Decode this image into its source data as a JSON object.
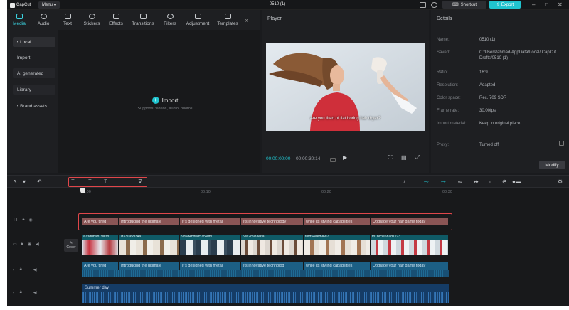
{
  "app": {
    "logo_text": "CapCut",
    "menu_label": "Menu",
    "doc_title": "0510 (1)",
    "shortcut_label": "Shortcut",
    "export_label": "Export"
  },
  "colors": {
    "accent": "#20c4cf",
    "highlight_box": "#e0464a",
    "text_clip": "#8a5555",
    "video_clip": "#0f5a66",
    "audio_clip": "#1c5f85"
  },
  "media_tabs": [
    {
      "label": "Media",
      "icon": "media-icon"
    },
    {
      "label": "Audio",
      "icon": "audio-icon"
    },
    {
      "label": "Text",
      "icon": "text-icon"
    },
    {
      "label": "Stickers",
      "icon": "stickers-icon"
    },
    {
      "label": "Effects",
      "icon": "effects-icon"
    },
    {
      "label": "Transitions",
      "icon": "transitions-icon"
    },
    {
      "label": "Filters",
      "icon": "filters-icon"
    },
    {
      "label": "Adjustment",
      "icon": "adjustment-icon"
    },
    {
      "label": "Templates",
      "icon": "templates-icon"
    }
  ],
  "media_sidebar": {
    "local": "• Local",
    "import": "Import",
    "ai_generated": "AI generated",
    "library": "Library",
    "brand_assets": "• Brand assets"
  },
  "import_area": {
    "label": "Import",
    "hint": "Supports: videos, audio, photos"
  },
  "player": {
    "title": "Player",
    "subtitle": "Are you tired of flat boring hair dryer?",
    "current_time": "00:00:00:00",
    "total_time": "00:00:30:14"
  },
  "details": {
    "title": "Details",
    "rows": [
      {
        "key": "Name:",
        "value": "0510 (1)"
      },
      {
        "key": "Saved:",
        "value": "C:/Users/ahmad/AppData/Local/ CapCut Drafts/0510 (1)"
      },
      {
        "key": "Ratio:",
        "value": "16:9"
      },
      {
        "key": "Resolution:",
        "value": "Adapted"
      },
      {
        "key": "Color space:",
        "value": "Rec. 709 SDR"
      },
      {
        "key": "Frame rate:",
        "value": "30.00fps"
      },
      {
        "key": "Import material:",
        "value": "Keep in original place"
      },
      {
        "key": "Proxy:",
        "value": "Turned off"
      }
    ],
    "modify_label": "Modify"
  },
  "timeline": {
    "ruler": [
      "00:00",
      "00:10",
      "00:20",
      "00:30"
    ],
    "cover_label": "Cover",
    "text_clips": [
      "Are you tired",
      "Introducing the ultimate",
      "It's designed with metal",
      "Its innovative technology",
      "while its styling capabilities",
      "Upgrade your hair game today"
    ],
    "video_clips": [
      "a73d0b9b19a3b",
      "7f33095934a",
      "9b5d4bd0d57c40f9",
      "5e62d983e6a",
      "f8fd54aed96d7",
      "fb1bc3e5b1d1273"
    ],
    "audio_clips": [
      "Are you tired",
      "Introducing the ultimate",
      "It's designed with metal",
      "Its innovative technolog",
      "while its styling capabilities",
      "Upgrade your hair game today"
    ],
    "music_label": "Summer day"
  }
}
